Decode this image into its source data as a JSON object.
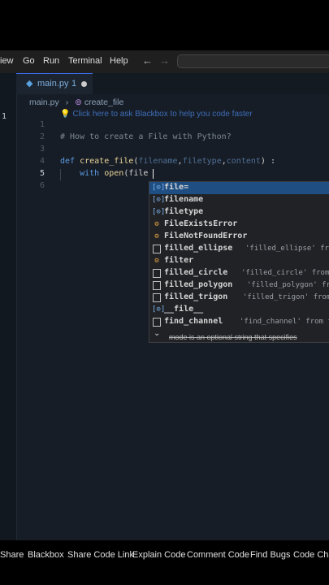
{
  "menu": {
    "items": [
      "iew",
      "Go",
      "Run",
      "Terminal",
      "Help"
    ]
  },
  "tab": {
    "label": "main.py",
    "problem_count": "1"
  },
  "breadcrumb": {
    "file": "main.py",
    "symbol": "create_file"
  },
  "hint": "Click here to ask Blackbox to help you code faster",
  "line_numbers": [
    "1",
    "2",
    "3",
    "4",
    "5",
    "6"
  ],
  "code": {
    "comment": "# How to create a File with Python?",
    "def_kw": "def",
    "func_name": "create_file",
    "params": [
      "filename",
      "filetype",
      "content"
    ],
    "with_kw": "with",
    "open_call": "open",
    "typed": "file"
  },
  "suggestions": [
    {
      "icon": "variable-icon",
      "label": "file=",
      "detail": ""
    },
    {
      "icon": "variable-icon",
      "label": "filename",
      "detail": ""
    },
    {
      "icon": "variable-icon",
      "label": "filetype",
      "detail": ""
    },
    {
      "icon": "class-icon",
      "label": "FileExistsError",
      "detail": ""
    },
    {
      "icon": "class-icon",
      "label": "FileNotFoundError",
      "detail": ""
    },
    {
      "icon": "text-icon",
      "label": "filled_ellipse",
      "detail": "'filled_ellipse' from"
    },
    {
      "icon": "class-icon",
      "label": "filter",
      "detail": ""
    },
    {
      "icon": "text-icon",
      "label": "filled_circle",
      "detail": "'filled_circle' from"
    },
    {
      "icon": "text-icon",
      "label": "filled_polygon",
      "detail": "'filled_polygon' fro"
    },
    {
      "icon": "text-icon",
      "label": "filled_trigon",
      "detail": "'filled_trigon' from"
    },
    {
      "icon": "variable-icon",
      "label": "__file__",
      "detail": ""
    },
    {
      "icon": "text-icon",
      "label": "find_channel",
      "detail": "'find_channel' from th"
    }
  ],
  "info": "mode is an optional string that specifies",
  "status": [
    "Share",
    "Blackbox",
    "Share Code Link",
    "Explain Code",
    "Comment Code",
    "Find Bugs",
    "Code Chat"
  ]
}
